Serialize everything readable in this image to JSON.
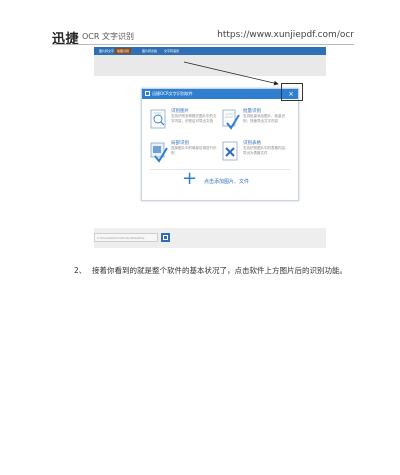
{
  "header": {
    "brand": "迅捷",
    "brand_sub": "OCR 文字识别",
    "url": "https://www.xunjiepdf.com/ocr"
  },
  "app_menu": {
    "items": [
      "图片转文字",
      "截图识别",
      "图片转表格",
      "文字转语音"
    ],
    "active_index": 1
  },
  "dialog": {
    "title": "迅捷OCR文字识别软件",
    "close_glyph": "×",
    "items": [
      {
        "name": "识别图片",
        "desc": "支持识别多种格式图片中的文字内容，识别后可导出文档"
      },
      {
        "name": "批量识别",
        "desc": "支持批量添加图片，批量识别，快速导出文字内容"
      },
      {
        "name": "局部识别",
        "desc": "选择图片中的局部区域进行识别"
      },
      {
        "name": "识别表格",
        "desc": "支持识别图片中的表格内容，导出为表格文件"
      }
    ],
    "add_glyph": "+",
    "add_label": "点击添加图片、文件"
  },
  "toolbar2": {
    "path_text": "C:\\Users\\Administrator\\Desktop"
  },
  "step": {
    "number": "2、",
    "text": "接着你看到的就是整个软件的基本状况了，点击软件上方图片后的识别功能。"
  },
  "colors": {
    "accent": "#2f6fb5",
    "active_menu": "#8a4b1f",
    "titlebar": "#2f7fd0",
    "check": "#2f7fd0"
  }
}
